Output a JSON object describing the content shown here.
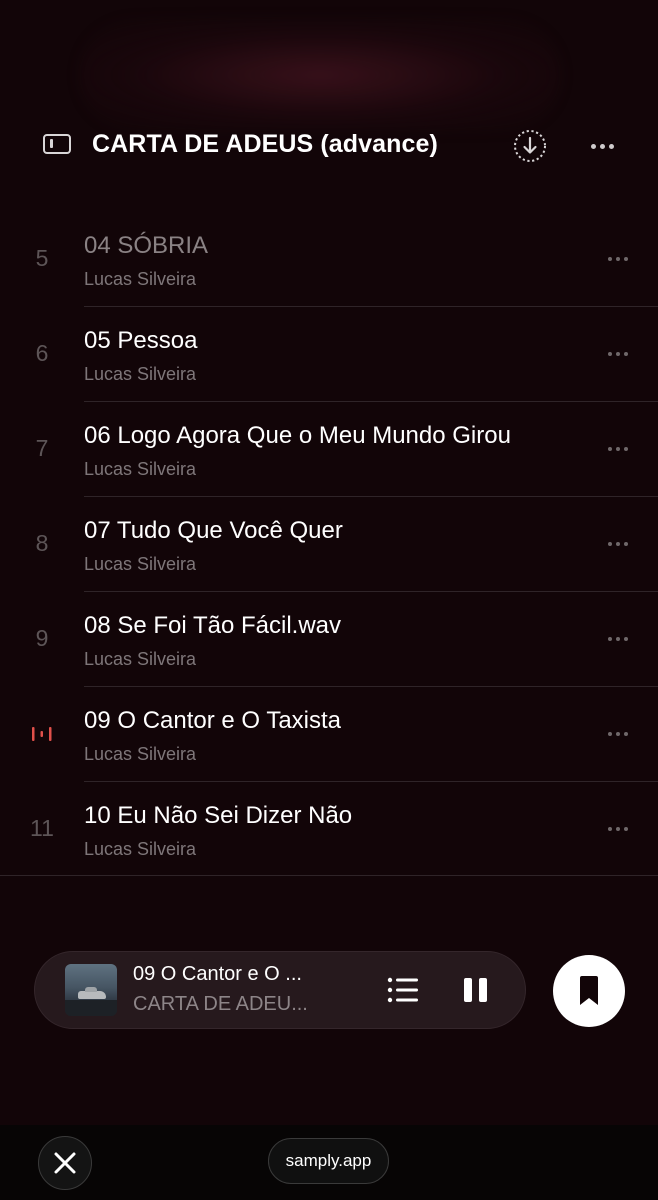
{
  "header": {
    "title": "CARTA DE ADEUS (advance)"
  },
  "tracks": [
    {
      "number": "5",
      "title": "04 SÓBRIA",
      "artist": "Lucas Silveira",
      "state": "dim"
    },
    {
      "number": "6",
      "title": "05 Pessoa",
      "artist": "Lucas Silveira",
      "state": "normal"
    },
    {
      "number": "7",
      "title": "06 Logo Agora Que o Meu Mundo Girou",
      "artist": "Lucas Silveira",
      "state": "normal"
    },
    {
      "number": "8",
      "title": "07 Tudo Que Você Quer",
      "artist": "Lucas Silveira",
      "state": "normal"
    },
    {
      "number": "9",
      "title": "08 Se Foi Tão Fácil.wav",
      "artist": "Lucas Silveira",
      "state": "normal"
    },
    {
      "number": "",
      "title": "09 O Cantor e O Taxista",
      "artist": "Lucas Silveira",
      "state": "playing"
    },
    {
      "number": "11",
      "title": "10 Eu Não Sei Dizer Não",
      "artist": "Lucas Silveira",
      "state": "normal"
    }
  ],
  "now_playing": {
    "title": "09 O Cantor e O ...",
    "album": "CARTA DE ADEU..."
  },
  "browser": {
    "url": "samply.app"
  },
  "colors": {
    "background": "#120508",
    "playing_accent": "#e0504a",
    "mini_player_bg": "#26191d"
  },
  "icons": {
    "sidebar": "sidebar-toggle-icon",
    "download": "download-icon",
    "more": "more-icon",
    "playing": "playing-bars-icon",
    "queue": "queue-list-icon",
    "pause": "pause-icon",
    "bookmark": "bookmark-icon",
    "close": "close-icon"
  }
}
